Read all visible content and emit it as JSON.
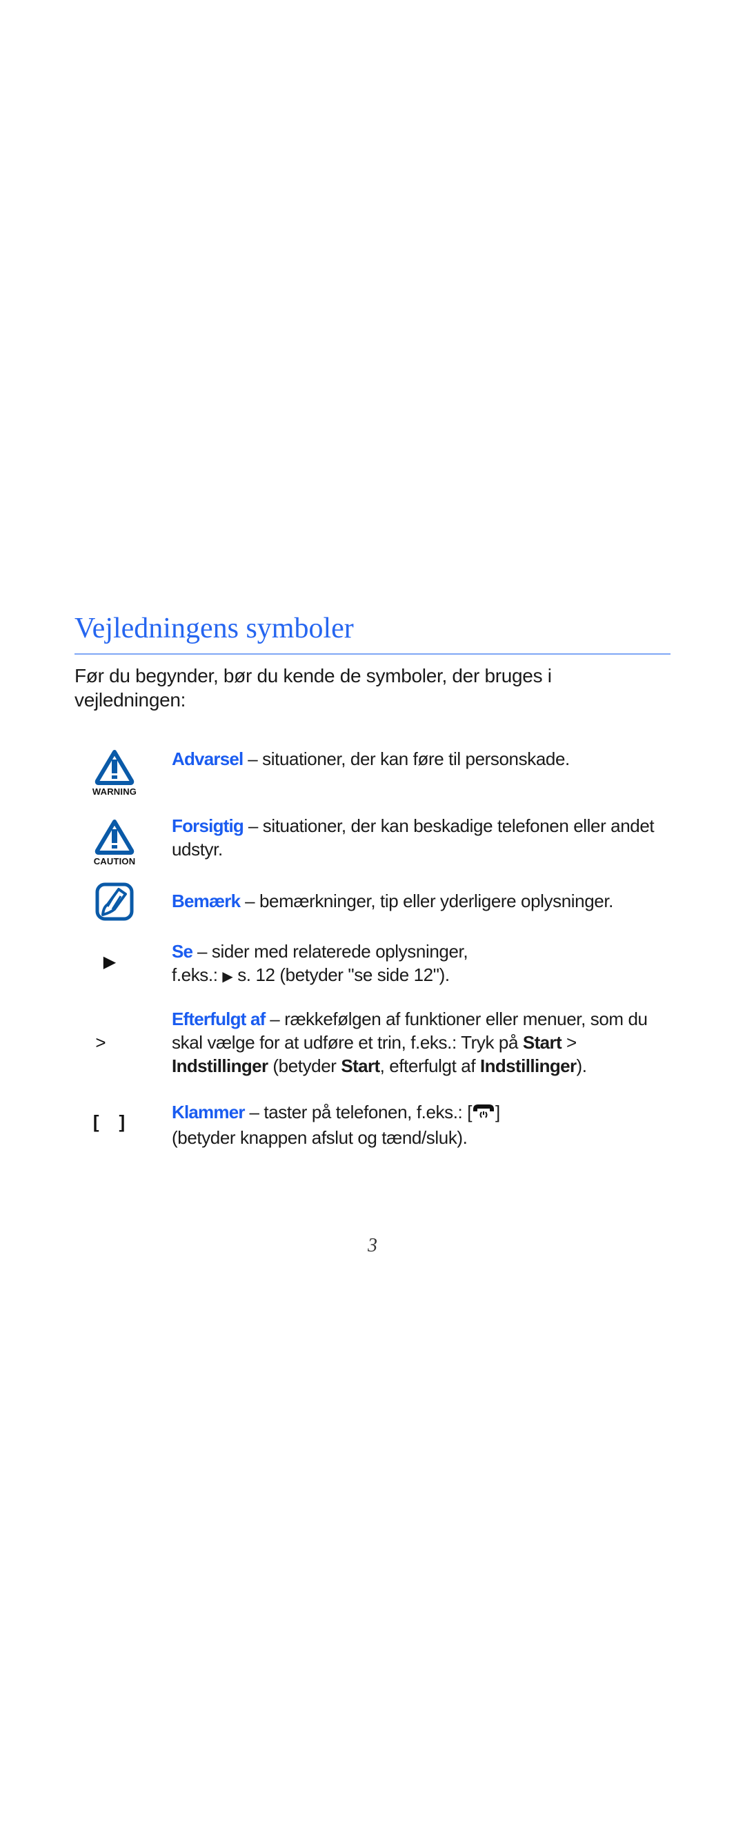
{
  "page": {
    "title": "Vejledningens symboler",
    "intro": "Før du begynder, bør du kende de symboler, der bruges i vejledningen:",
    "page_number": "3",
    "accent_color": "#2666f0"
  },
  "symbols": [
    {
      "icon": "warning-icon",
      "icon_label": "WARNING",
      "keyword": "Advarsel",
      "text": " – situationer, der kan føre til personskade."
    },
    {
      "icon": "caution-icon",
      "icon_label": "CAUTION",
      "keyword": "Forsigtig",
      "text": " – situationer, der kan beskadige telefonen eller andet udstyr."
    },
    {
      "icon": "note-icon",
      "keyword": "Bemærk",
      "text": " – bemærkninger, tip eller yderligere oplysninger."
    },
    {
      "icon": "see-reference-icon",
      "glyph": "▶",
      "keyword": "Se",
      "text_line1": " – sider med relaterede oplysninger,",
      "text_line2_pre": "f.eks.: ",
      "text_line2_arrow": "▶",
      "text_line2_post": " s. 12 (betyder \"se side 12\")."
    },
    {
      "icon": "followed-by-icon",
      "glyph": ">",
      "keyword": "Efterfulgt af",
      "text_a": " – rækkefølgen af funktioner eller menuer, som du skal vælge for at udføre et trin, f.eks.: Tryk på ",
      "bold_1": "Start",
      "text_b": " > ",
      "bold_2": "Indstillinger",
      "text_c": " (betyder ",
      "bold_3": "Start",
      "text_d": ", efterfulgt af ",
      "bold_4": "Indstillinger",
      "text_e": ")."
    },
    {
      "icon": "brackets-icon",
      "glyph": "[    ]",
      "keyword": "Klammer",
      "text_a": " – taster på telefonen, f.eks.: [",
      "key_icon": "end-power-key-icon",
      "text_b": "]",
      "text_line2": "(betyder knappen afslut og tænd/sluk)."
    }
  ]
}
